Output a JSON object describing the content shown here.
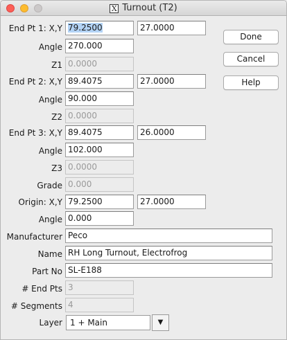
{
  "window": {
    "title": "Turnout (T2)",
    "title_icon": "X"
  },
  "fields": {
    "ep1_label": "End Pt 1: X,Y",
    "ep1_x_selected": "79.2500",
    "ep1_y": "27.0000",
    "angle1_label": "Angle",
    "angle1": "270.000",
    "z1_label": "Z1",
    "z1": "0.0000",
    "ep2_label": "End Pt 2: X,Y",
    "ep2_x": "89.4075",
    "ep2_y": "27.0000",
    "angle2_label": "Angle",
    "angle2": "90.000",
    "z2_label": "Z2",
    "z2": "0.0000",
    "ep3_label": "End Pt 3: X,Y",
    "ep3_x": "89.4075",
    "ep3_y": "26.0000",
    "angle3_label": "Angle",
    "angle3": "102.000",
    "z3_label": "Z3",
    "z3": "0.0000",
    "grade_label": "Grade",
    "grade": "0.000",
    "origin_label": "Origin: X,Y",
    "origin_x": "79.2500",
    "origin_y": "27.0000",
    "angle_o_label": "Angle",
    "angle_o": "0.000",
    "manufacturer_label": "Manufacturer",
    "manufacturer": "Peco",
    "name_label": "Name",
    "name": "RH Long Turnout, Electrofrog",
    "partno_label": "Part No",
    "partno": "SL-E188",
    "endpts_label": "# End Pts",
    "endpts": "3",
    "segments_label": "# Segments",
    "segments": "4",
    "layer_label": "Layer",
    "layer": "1 + Main"
  },
  "buttons": {
    "done": "Done",
    "cancel": "Cancel",
    "help": "Help"
  },
  "icons": {
    "dropdown": "▼"
  }
}
